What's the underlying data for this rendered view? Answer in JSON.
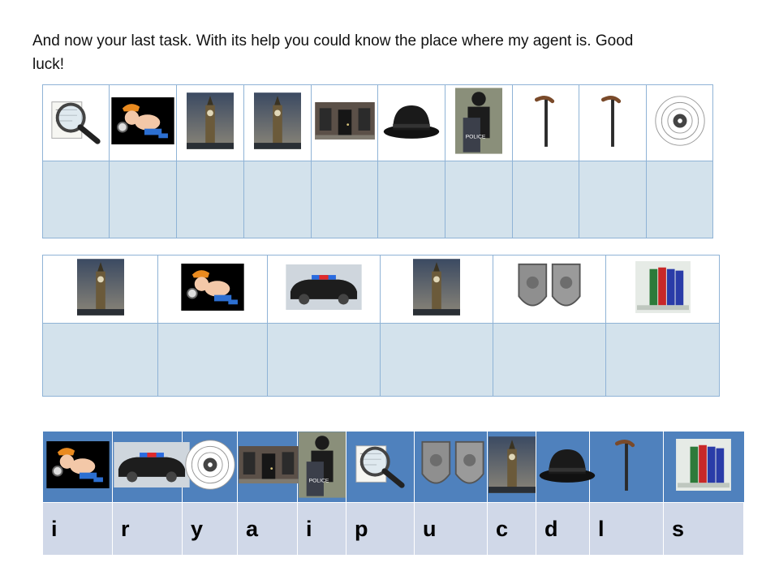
{
  "intro_text": "And now your last task. With its help you could know the place where my agent is. Good luck!",
  "puzzle1": {
    "pictures": [
      "magnifier-icon",
      "detective-icon",
      "big-ben-icon",
      "big-ben-icon",
      "door-icon",
      "bowler-hat-icon",
      "police-officer-icon",
      "cane-icon",
      "cane-icon",
      "target-icon"
    ],
    "answers": [
      "",
      "",
      "",
      "",
      "",
      "",
      "",
      "",
      "",
      ""
    ]
  },
  "puzzle2": {
    "pictures": [
      "big-ben-icon",
      "detective-icon",
      "police-car-icon",
      "big-ben-icon",
      "badges-icon",
      "binders-icon"
    ],
    "answers": [
      "",
      "",
      "",
      "",
      "",
      ""
    ]
  },
  "key": [
    {
      "icon": "detective-icon",
      "letter": "i"
    },
    {
      "icon": "police-car-icon",
      "letter": "r"
    },
    {
      "icon": "target-icon",
      "letter": "y"
    },
    {
      "icon": "door-icon",
      "letter": "a"
    },
    {
      "icon": "police-officer-icon",
      "letter": "i"
    },
    {
      "icon": "magnifier-icon",
      "letter": "p"
    },
    {
      "icon": "badges-icon",
      "letter": "u"
    },
    {
      "icon": "big-ben-icon",
      "letter": "c"
    },
    {
      "icon": "bowler-hat-icon",
      "letter": "d"
    },
    {
      "icon": "cane-icon",
      "letter": "l"
    },
    {
      "icon": "binders-icon",
      "letter": "s"
    }
  ]
}
